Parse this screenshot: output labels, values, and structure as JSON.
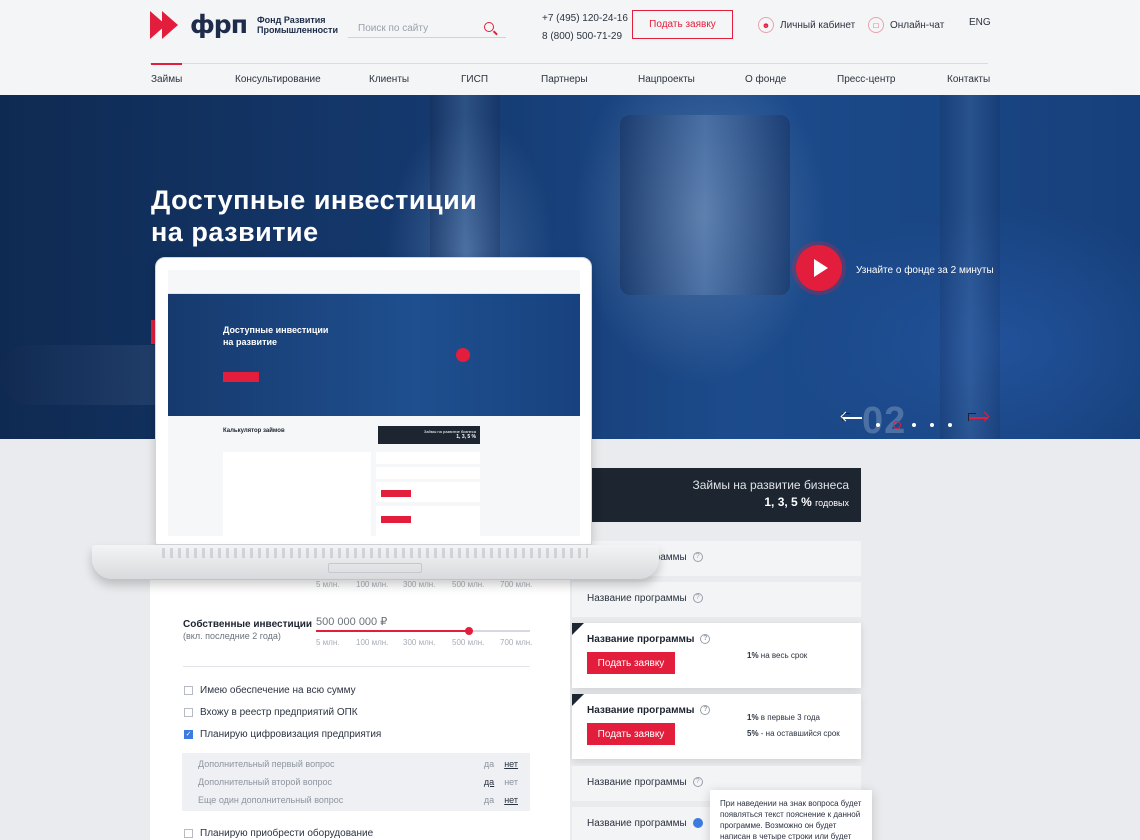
{
  "header": {
    "logo_word": "фрп",
    "logo_sub": "Фонд Развития Промышленности",
    "search_placeholder": "Поиск по сайту",
    "phone1": "+7 (495) 120-24-16",
    "phone2": "8 (800) 500-71-29",
    "apply_label": "Подать заявку",
    "cabinet_label": "Личный кабинет",
    "chat_label": "Онлайн-чат",
    "lang_label": "ENG"
  },
  "nav": [
    "Займы",
    "Консультирование",
    "Клиенты",
    "ГИСП",
    "Партнеры",
    "Нацпроекты",
    "О фонде",
    "Пресс-центр",
    "Контакты"
  ],
  "hero": {
    "title_line1": "Доступные инвестиции",
    "title_line2": "на развитие",
    "video_label": "Узнайте о фонде за 2 минуты",
    "slide_number": "02",
    "dots": 5,
    "active_dot": 2
  },
  "laptop_preview": {
    "title_line1": "Доступные инвестиции",
    "title_line2": "на развитие",
    "calc_title": "Калькулятор займов",
    "promo": "Займы на развитие бизнеса",
    "promo_rate": "1, 3, 5 %"
  },
  "promo": {
    "title": "Займы на развитие бизнеса",
    "rate": "1, 3, 5 %",
    "rate_unit": "годовых"
  },
  "programs": {
    "name": "Название программы",
    "apply_label": "Подать заявку",
    "card1_rate_bold": "1%",
    "card1_rate_text": "на весь срок",
    "card2_rate1_bold": "1%",
    "card2_rate1_text": "в первые 3 года",
    "card2_rate2_bold": "5%",
    "card2_rate2_text": "- на оставшийся срок",
    "tooltip": "При наведении на знак вопроса будет появляться текст пояснение к данной программе. Возможно он будет написан в четыре строки или будет"
  },
  "calc": {
    "scale": [
      "5 млн.",
      "100 млн.",
      "300 млн.",
      "500 млн.",
      "700 млн."
    ],
    "own_label": "Собственные инвестиции",
    "own_sub": "(вкл. последние 2 года)",
    "own_value": "500 000 000 ₽",
    "own_fraction": 0.7,
    "checks": [
      {
        "label": "Имею обеспечение на всю сумму",
        "checked": false
      },
      {
        "label": "Вхожу в реестр предприятий ОПК",
        "checked": false
      },
      {
        "label": "Планирую цифровизация предприятия",
        "checked": true
      }
    ],
    "questions": [
      {
        "text": "Дополнительный первый вопрос",
        "yes": "да",
        "no": "нет",
        "selected": "no"
      },
      {
        "text": "Дополнительный второй вопрос",
        "yes": "да",
        "no": "нет",
        "selected": "yes"
      },
      {
        "text": "Еще один дополнительный вопрос",
        "yes": "да",
        "no": "нет",
        "selected": "no"
      }
    ],
    "last_check": "Планирую приобрести оборудование"
  }
}
